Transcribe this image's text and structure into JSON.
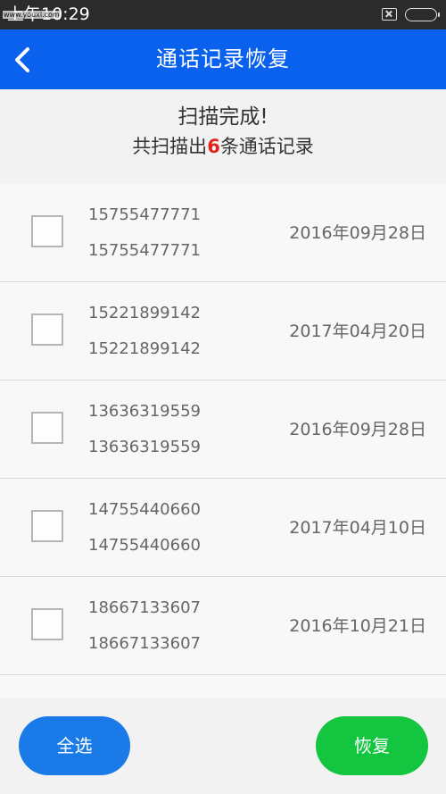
{
  "status_bar": {
    "time": "上午10:29",
    "watermark": "www.youxi.com"
  },
  "app_bar": {
    "title": "通话记录恢复",
    "back_icon": "chevron-left-icon"
  },
  "scan_summary": {
    "done_text": "扫描完成!",
    "count_prefix": "共扫描出",
    "count": "6",
    "count_suffix": "条通话记录"
  },
  "records": [
    {
      "name": "15755477771",
      "number": "15755477771",
      "date": "2016年09月28日",
      "checked": false
    },
    {
      "name": "15221899142",
      "number": "15221899142",
      "date": "2017年04月20日",
      "checked": false
    },
    {
      "name": "13636319559",
      "number": "13636319559",
      "date": "2016年09月28日",
      "checked": false
    },
    {
      "name": "14755440660",
      "number": "14755440660",
      "date": "2017年04月10日",
      "checked": false
    },
    {
      "name": "18667133607",
      "number": "18667133607",
      "date": "2016年10月21日",
      "checked": false
    }
  ],
  "buttons": {
    "select_all": "全选",
    "restore": "恢复"
  },
  "colors": {
    "app_bar": "#0a61ed",
    "select_all_button": "#1a7be8",
    "restore_button": "#13c53f",
    "count_highlight": "#e2231a"
  }
}
